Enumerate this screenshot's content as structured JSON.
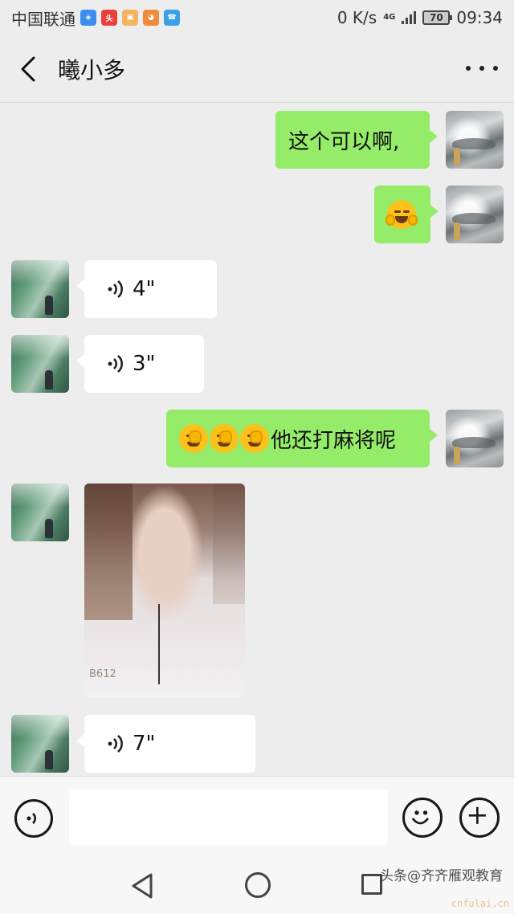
{
  "status_bar": {
    "carrier": "中国联通",
    "net_speed": "0 K/s",
    "net_type": "4G",
    "battery": "70",
    "time": "09:34"
  },
  "header": {
    "title": "曦小多"
  },
  "messages": [
    {
      "side": "sent",
      "type": "text",
      "text": "这个可以啊,"
    },
    {
      "side": "sent",
      "type": "emoji",
      "emoji": "hugging-face"
    },
    {
      "side": "recv",
      "type": "voice",
      "duration": "4\""
    },
    {
      "side": "recv",
      "type": "voice",
      "duration": "3\""
    },
    {
      "side": "sent",
      "type": "text",
      "emoji_prefix": [
        "facepalm",
        "facepalm",
        "facepalm"
      ],
      "text": "他还打麻将呢"
    },
    {
      "side": "recv",
      "type": "image",
      "watermark": "B612"
    },
    {
      "side": "recv",
      "type": "voice",
      "duration": "7\""
    }
  ],
  "input_bar": {
    "placeholder": ""
  },
  "watermark": {
    "text": "头条@齐齐雁观教育",
    "site": "cnfulai.cn"
  }
}
